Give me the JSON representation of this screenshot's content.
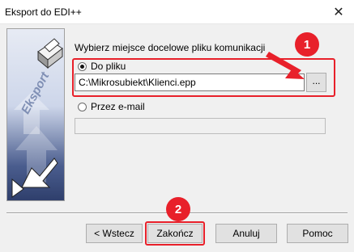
{
  "window": {
    "title": "Eksport do EDI++",
    "close_glyph": "✕"
  },
  "banner": {
    "label": "Eksport",
    "icon": "export-arrows-banner"
  },
  "form": {
    "prompt": "Wybierz miejsce docelowe pliku komunikacji",
    "to_file_label": "Do pliku",
    "to_file_selected": true,
    "file_path": "C:\\Mikrosubiekt\\Klienci.epp",
    "browse_label": "...",
    "email_label": "Przez e-mail",
    "email_selected": false,
    "email_value": ""
  },
  "annotations": {
    "badge_1": "1",
    "badge_2": "2",
    "highlight_color": "#e8202a"
  },
  "buttons": {
    "back": "< Wstecz",
    "finish": "Zakończ",
    "cancel": "Anuluj",
    "help": "Pomoc"
  }
}
